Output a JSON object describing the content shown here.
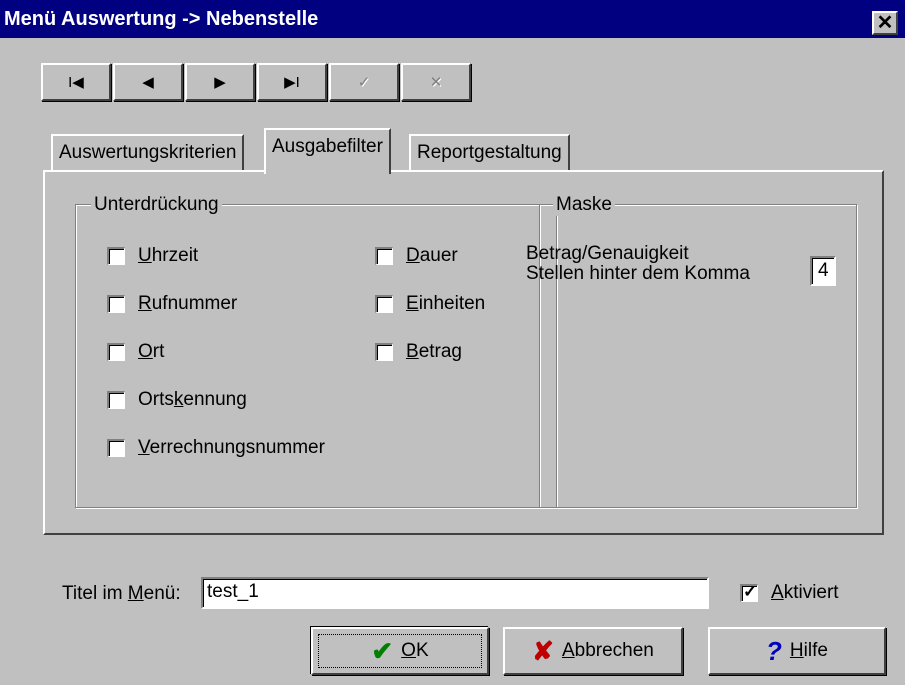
{
  "window": {
    "title": "Menü Auswertung -> Nebenstelle",
    "close_icon": "close-icon"
  },
  "toolbar": {
    "buttons": [
      {
        "icon": "first-record-icon",
        "glyph": "I◀",
        "enabled": true
      },
      {
        "icon": "previous-record-icon",
        "glyph": "◀",
        "enabled": true
      },
      {
        "icon": "next-record-icon",
        "glyph": "▶",
        "enabled": true
      },
      {
        "icon": "last-record-icon",
        "glyph": "▶I",
        "enabled": true
      },
      {
        "icon": "checkmark-icon",
        "glyph": "✓",
        "enabled": false
      },
      {
        "icon": "cross-icon",
        "glyph": "✕",
        "enabled": false
      }
    ]
  },
  "tabs": [
    {
      "label": "Auswertungskriterien",
      "active": false
    },
    {
      "label": "Ausgabefilter",
      "active": true
    },
    {
      "label": "Reportgestaltung",
      "active": false
    }
  ],
  "suppression": {
    "title": "Unterdrückung",
    "left_items": [
      {
        "pre": "",
        "key": "U",
        "post": "hrzeit",
        "checked": false
      },
      {
        "pre": "",
        "key": "R",
        "post": "ufnummer",
        "checked": false
      },
      {
        "pre": "",
        "key": "O",
        "post": "rt",
        "checked": false
      },
      {
        "pre": "Orts",
        "key": "k",
        "post": "ennung",
        "checked": false
      },
      {
        "pre": "",
        "key": "V",
        "post": "errechnungsnummer",
        "checked": false
      }
    ],
    "right_items": [
      {
        "pre": "",
        "key": "D",
        "post": "auer",
        "checked": false
      },
      {
        "pre": "",
        "key": "E",
        "post": "inheiten",
        "checked": false
      },
      {
        "pre": "",
        "key": "B",
        "post": "etrag",
        "checked": false
      }
    ]
  },
  "mask": {
    "title": "Maske",
    "label_line1": "Betrag/Genauigkeit",
    "label_line2": "Stellen hinter dem Komma",
    "value": "4"
  },
  "menu_title": {
    "label_pre": "Titel im ",
    "label_key": "M",
    "label_post": "enü:",
    "value": "test_1"
  },
  "activated": {
    "key": "A",
    "post": "ktiviert",
    "checked": true
  },
  "actions": {
    "ok": {
      "key": "O",
      "post": "K",
      "icon": "checkmark-icon",
      "icon_color": "#008000"
    },
    "cancel": {
      "key": "A",
      "post": "bbrechen",
      "icon": "cross-icon",
      "icon_color": "#c00000"
    },
    "help": {
      "key": "H",
      "post": "ilfe",
      "icon": "help-icon",
      "icon_color": "#0000c0"
    }
  }
}
